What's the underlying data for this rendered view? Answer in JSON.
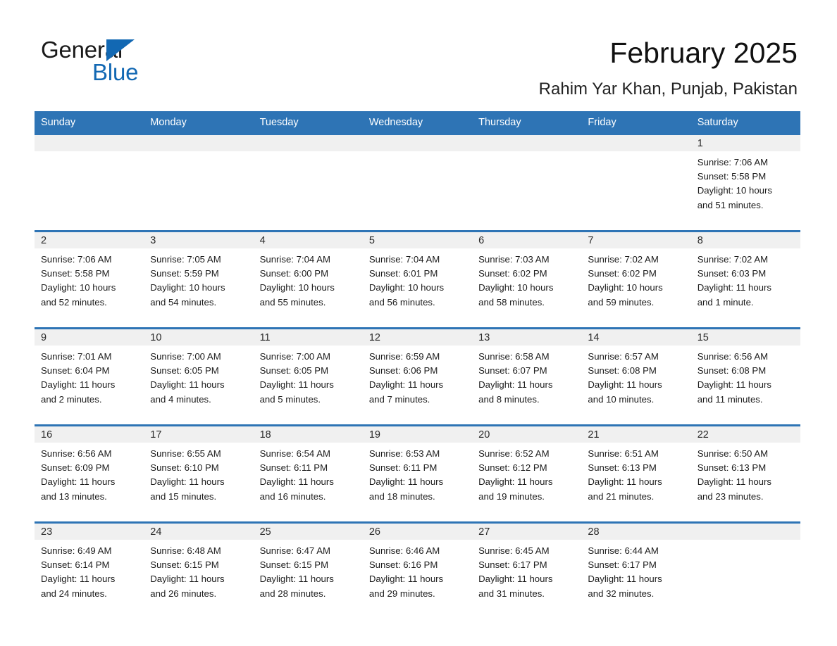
{
  "brand": {
    "name_part1": "General",
    "name_part2": "Blue",
    "triangle_icon": "triangle-icon",
    "accent_color": "#1268b3"
  },
  "header": {
    "title": "February 2025",
    "subtitle": "Rahim Yar Khan, Punjab, Pakistan"
  },
  "theme": {
    "header_blue": "#2E74B5",
    "daynum_band": "#F0F0F0",
    "text": "#1C1C1C"
  },
  "calendar": {
    "day_headers": [
      "Sunday",
      "Monday",
      "Tuesday",
      "Wednesday",
      "Thursday",
      "Friday",
      "Saturday"
    ],
    "weeks": [
      [
        {
          "day": "",
          "sunrise": "",
          "sunset": "",
          "daylight_line1": "",
          "daylight_line2": ""
        },
        {
          "day": "",
          "sunrise": "",
          "sunset": "",
          "daylight_line1": "",
          "daylight_line2": ""
        },
        {
          "day": "",
          "sunrise": "",
          "sunset": "",
          "daylight_line1": "",
          "daylight_line2": ""
        },
        {
          "day": "",
          "sunrise": "",
          "sunset": "",
          "daylight_line1": "",
          "daylight_line2": ""
        },
        {
          "day": "",
          "sunrise": "",
          "sunset": "",
          "daylight_line1": "",
          "daylight_line2": ""
        },
        {
          "day": "",
          "sunrise": "",
          "sunset": "",
          "daylight_line1": "",
          "daylight_line2": ""
        },
        {
          "day": "1",
          "sunrise": "Sunrise: 7:06 AM",
          "sunset": "Sunset: 5:58 PM",
          "daylight_line1": "Daylight: 10 hours",
          "daylight_line2": "and 51 minutes."
        }
      ],
      [
        {
          "day": "2",
          "sunrise": "Sunrise: 7:06 AM",
          "sunset": "Sunset: 5:58 PM",
          "daylight_line1": "Daylight: 10 hours",
          "daylight_line2": "and 52 minutes."
        },
        {
          "day": "3",
          "sunrise": "Sunrise: 7:05 AM",
          "sunset": "Sunset: 5:59 PM",
          "daylight_line1": "Daylight: 10 hours",
          "daylight_line2": "and 54 minutes."
        },
        {
          "day": "4",
          "sunrise": "Sunrise: 7:04 AM",
          "sunset": "Sunset: 6:00 PM",
          "daylight_line1": "Daylight: 10 hours",
          "daylight_line2": "and 55 minutes."
        },
        {
          "day": "5",
          "sunrise": "Sunrise: 7:04 AM",
          "sunset": "Sunset: 6:01 PM",
          "daylight_line1": "Daylight: 10 hours",
          "daylight_line2": "and 56 minutes."
        },
        {
          "day": "6",
          "sunrise": "Sunrise: 7:03 AM",
          "sunset": "Sunset: 6:02 PM",
          "daylight_line1": "Daylight: 10 hours",
          "daylight_line2": "and 58 minutes."
        },
        {
          "day": "7",
          "sunrise": "Sunrise: 7:02 AM",
          "sunset": "Sunset: 6:02 PM",
          "daylight_line1": "Daylight: 10 hours",
          "daylight_line2": "and 59 minutes."
        },
        {
          "day": "8",
          "sunrise": "Sunrise: 7:02 AM",
          "sunset": "Sunset: 6:03 PM",
          "daylight_line1": "Daylight: 11 hours",
          "daylight_line2": "and 1 minute."
        }
      ],
      [
        {
          "day": "9",
          "sunrise": "Sunrise: 7:01 AM",
          "sunset": "Sunset: 6:04 PM",
          "daylight_line1": "Daylight: 11 hours",
          "daylight_line2": "and 2 minutes."
        },
        {
          "day": "10",
          "sunrise": "Sunrise: 7:00 AM",
          "sunset": "Sunset: 6:05 PM",
          "daylight_line1": "Daylight: 11 hours",
          "daylight_line2": "and 4 minutes."
        },
        {
          "day": "11",
          "sunrise": "Sunrise: 7:00 AM",
          "sunset": "Sunset: 6:05 PM",
          "daylight_line1": "Daylight: 11 hours",
          "daylight_line2": "and 5 minutes."
        },
        {
          "day": "12",
          "sunrise": "Sunrise: 6:59 AM",
          "sunset": "Sunset: 6:06 PM",
          "daylight_line1": "Daylight: 11 hours",
          "daylight_line2": "and 7 minutes."
        },
        {
          "day": "13",
          "sunrise": "Sunrise: 6:58 AM",
          "sunset": "Sunset: 6:07 PM",
          "daylight_line1": "Daylight: 11 hours",
          "daylight_line2": "and 8 minutes."
        },
        {
          "day": "14",
          "sunrise": "Sunrise: 6:57 AM",
          "sunset": "Sunset: 6:08 PM",
          "daylight_line1": "Daylight: 11 hours",
          "daylight_line2": "and 10 minutes."
        },
        {
          "day": "15",
          "sunrise": "Sunrise: 6:56 AM",
          "sunset": "Sunset: 6:08 PM",
          "daylight_line1": "Daylight: 11 hours",
          "daylight_line2": "and 11 minutes."
        }
      ],
      [
        {
          "day": "16",
          "sunrise": "Sunrise: 6:56 AM",
          "sunset": "Sunset: 6:09 PM",
          "daylight_line1": "Daylight: 11 hours",
          "daylight_line2": "and 13 minutes."
        },
        {
          "day": "17",
          "sunrise": "Sunrise: 6:55 AM",
          "sunset": "Sunset: 6:10 PM",
          "daylight_line1": "Daylight: 11 hours",
          "daylight_line2": "and 15 minutes."
        },
        {
          "day": "18",
          "sunrise": "Sunrise: 6:54 AM",
          "sunset": "Sunset: 6:11 PM",
          "daylight_line1": "Daylight: 11 hours",
          "daylight_line2": "and 16 minutes."
        },
        {
          "day": "19",
          "sunrise": "Sunrise: 6:53 AM",
          "sunset": "Sunset: 6:11 PM",
          "daylight_line1": "Daylight: 11 hours",
          "daylight_line2": "and 18 minutes."
        },
        {
          "day": "20",
          "sunrise": "Sunrise: 6:52 AM",
          "sunset": "Sunset: 6:12 PM",
          "daylight_line1": "Daylight: 11 hours",
          "daylight_line2": "and 19 minutes."
        },
        {
          "day": "21",
          "sunrise": "Sunrise: 6:51 AM",
          "sunset": "Sunset: 6:13 PM",
          "daylight_line1": "Daylight: 11 hours",
          "daylight_line2": "and 21 minutes."
        },
        {
          "day": "22",
          "sunrise": "Sunrise: 6:50 AM",
          "sunset": "Sunset: 6:13 PM",
          "daylight_line1": "Daylight: 11 hours",
          "daylight_line2": "and 23 minutes."
        }
      ],
      [
        {
          "day": "23",
          "sunrise": "Sunrise: 6:49 AM",
          "sunset": "Sunset: 6:14 PM",
          "daylight_line1": "Daylight: 11 hours",
          "daylight_line2": "and 24 minutes."
        },
        {
          "day": "24",
          "sunrise": "Sunrise: 6:48 AM",
          "sunset": "Sunset: 6:15 PM",
          "daylight_line1": "Daylight: 11 hours",
          "daylight_line2": "and 26 minutes."
        },
        {
          "day": "25",
          "sunrise": "Sunrise: 6:47 AM",
          "sunset": "Sunset: 6:15 PM",
          "daylight_line1": "Daylight: 11 hours",
          "daylight_line2": "and 28 minutes."
        },
        {
          "day": "26",
          "sunrise": "Sunrise: 6:46 AM",
          "sunset": "Sunset: 6:16 PM",
          "daylight_line1": "Daylight: 11 hours",
          "daylight_line2": "and 29 minutes."
        },
        {
          "day": "27",
          "sunrise": "Sunrise: 6:45 AM",
          "sunset": "Sunset: 6:17 PM",
          "daylight_line1": "Daylight: 11 hours",
          "daylight_line2": "and 31 minutes."
        },
        {
          "day": "28",
          "sunrise": "Sunrise: 6:44 AM",
          "sunset": "Sunset: 6:17 PM",
          "daylight_line1": "Daylight: 11 hours",
          "daylight_line2": "and 32 minutes."
        },
        {
          "day": "",
          "sunrise": "",
          "sunset": "",
          "daylight_line1": "",
          "daylight_line2": ""
        }
      ]
    ]
  }
}
